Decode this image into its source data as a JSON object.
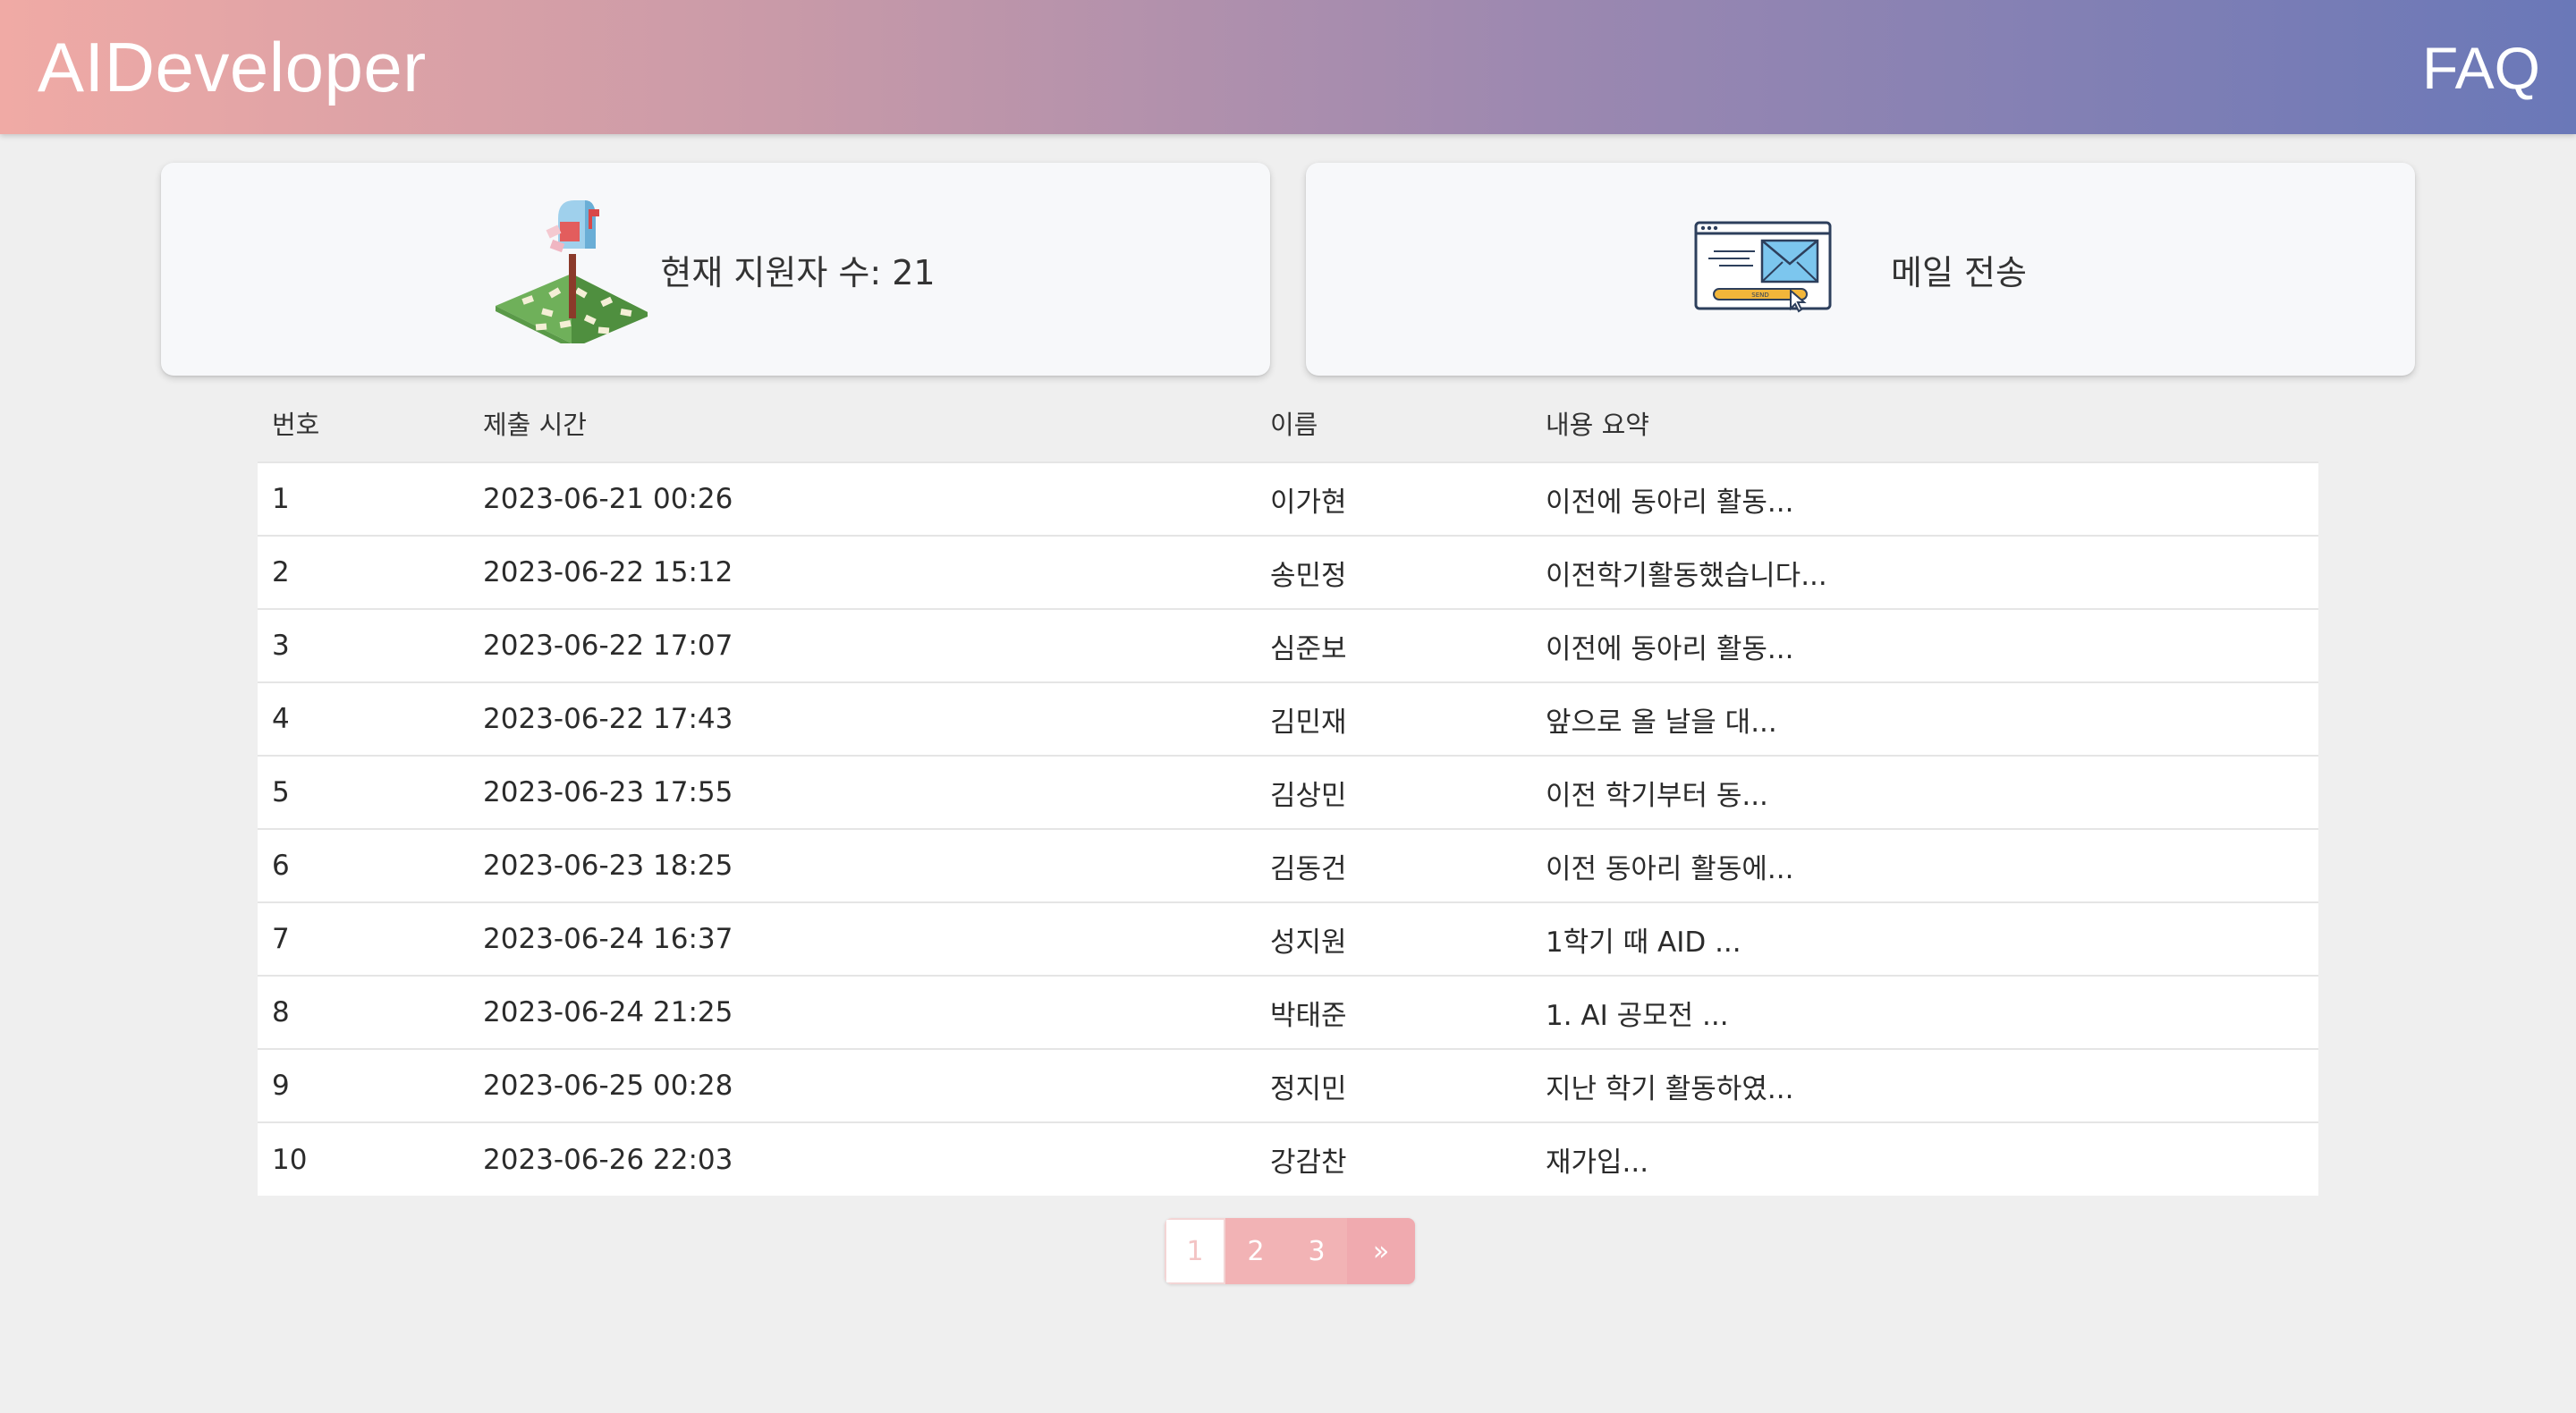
{
  "header": {
    "brand": "AIDeveloper",
    "faq_label": "FAQ"
  },
  "cards": {
    "applicants": {
      "text": "현재 지원자 수: 21",
      "icon": "mailbox-illustration"
    },
    "send_mail": {
      "text": "메일 전송",
      "icon": "email-send-illustration",
      "icon_button_text": "SEND"
    }
  },
  "table": {
    "columns": [
      "번호",
      "제출 시간",
      "이름",
      "내용 요약"
    ],
    "rows": [
      [
        "1",
        "2023-06-21 00:26",
        "이가현",
        "이전에 동아리 활동..."
      ],
      [
        "2",
        "2023-06-22 15:12",
        "송민정",
        "이전학기활동했습니다..."
      ],
      [
        "3",
        "2023-06-22 17:07",
        "심준보",
        "이전에 동아리 활동..."
      ],
      [
        "4",
        "2023-06-22 17:43",
        "김민재",
        "앞으로 올 날을 대..."
      ],
      [
        "5",
        "2023-06-23 17:55",
        "김상민",
        "이전 학기부터 동..."
      ],
      [
        "6",
        "2023-06-23 18:25",
        "김동건",
        "이전 동아리 활동에..."
      ],
      [
        "7",
        "2023-06-24 16:37",
        "성지원",
        "1학기 때 AID ..."
      ],
      [
        "8",
        "2023-06-24 21:25",
        "박태준",
        "1. AI 공모전 ..."
      ],
      [
        "9",
        "2023-06-25 00:28",
        "정지민",
        "지난 학기 활동하였..."
      ],
      [
        "10",
        "2023-06-26 22:03",
        "강감찬",
        "재가입..."
      ]
    ]
  },
  "pagination": {
    "pages": [
      "1",
      "2",
      "3"
    ],
    "active": "1",
    "next_label": "»"
  },
  "colors": {
    "header_gradient_start": "#f0aaa5",
    "header_gradient_end": "#6a78b8",
    "page_button": "#f2b3b5",
    "background": "#efefef"
  }
}
